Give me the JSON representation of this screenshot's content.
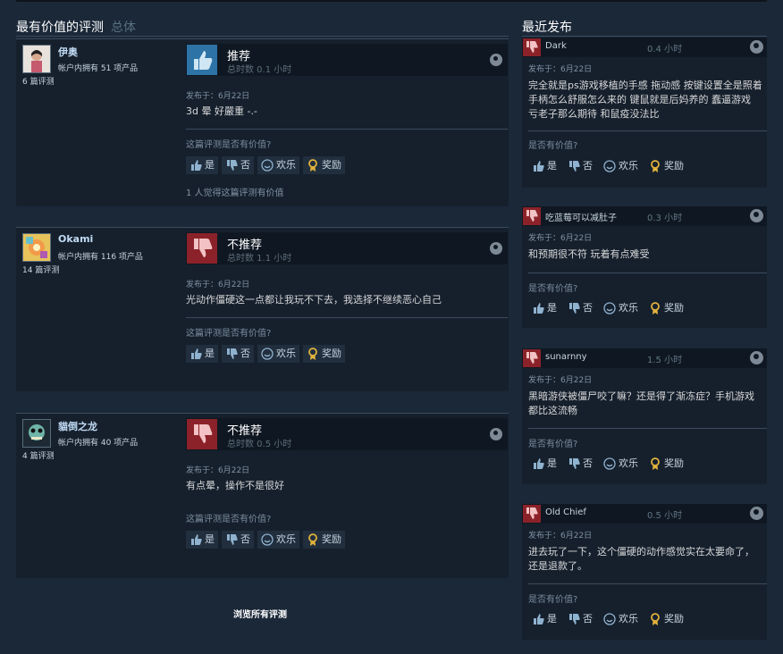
{
  "left_heading": {
    "title": "最有价值的评测",
    "subtitle": "总体"
  },
  "right_heading": {
    "title": "最近发布"
  },
  "vote_buttons": {
    "yes": "是",
    "no": "否",
    "funny": "欢乐",
    "award": "奖励"
  },
  "reviews": [
    {
      "author": "伊奥",
      "owned": "帐户内拥有 51 项产品",
      "review_count": "6 篇评测",
      "verdict": "推荐",
      "hours": "总时数 0.1 小时",
      "posted": "发布于：6月22日",
      "text": "3d 晕 好嚴重 -.-",
      "helpful_question": "这篇评测是否有价值?",
      "found_helpful": "1 人觉得这篇评测有价值"
    },
    {
      "author": "Okami",
      "owned": "帐户内拥有 116 项产品",
      "review_count": "14 篇评测",
      "verdict": "不推荐",
      "hours": "总时数 1.1 小时",
      "posted": "发布于：6月22日",
      "text": "光动作僵硬这一点都让我玩不下去，我选择不继续恶心自己",
      "helpful_question": "这篇评测是否有价值?"
    },
    {
      "author": "貓倒之龙",
      "owned": "帐户内拥有 40 项产品",
      "review_count": "4 篇评测",
      "verdict": "不推荐",
      "hours": "总时数 0.5 小时",
      "posted": "发布于：6月22日",
      "text": "有点晕，操作不是很好",
      "helpful_question": "这篇评测是否有价值?"
    }
  ],
  "browse_all": "浏览所有评测",
  "recent": [
    {
      "author": "Dark",
      "hours": "0.4 小时",
      "posted": "发布于：6月22日",
      "text": "完全就是ps游戏移植的手感 拖动感 按键设置全是照着手柄怎么舒服怎么来的 键鼠就是后妈养的 蠢逼游戏 亏老子那么期待 和鼠疫没法比",
      "helpful_question": "是否有价值?"
    },
    {
      "author": "吃蓝莓可以减肚子",
      "hours": "0.3 小时",
      "posted": "发布于：6月22日",
      "text": "和预期很不符 玩着有点难受",
      "helpful_question": "是否有价值?"
    },
    {
      "author": "sunarnny",
      "hours": "1.5 小时",
      "posted": "发布于：6月22日",
      "text": "黑暗游侠被僵尸咬了嘛？还是得了渐冻症？手机游戏都比这流畅",
      "helpful_question": "是否有价值?"
    },
    {
      "author": "Old Chief",
      "hours": "0.5 小时",
      "posted": "发布于：6月22日",
      "text": "进去玩了一下，这个僵硬的动作感觉实在太要命了，还是退款了。",
      "helpful_question": "是否有价值?"
    }
  ],
  "colors": {
    "background": "#1b2838",
    "recommended": "#2d73a6",
    "not_recommended": "#8c2229",
    "award": "#e0b23c"
  }
}
